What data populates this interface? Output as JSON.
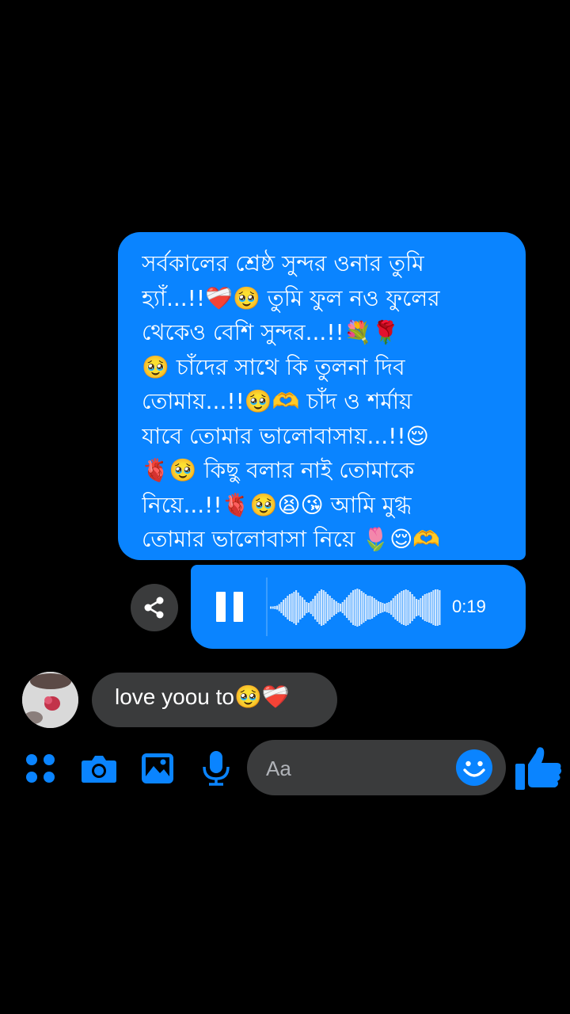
{
  "chat": {
    "sent_message_lines": [
      "সর্বকালের শ্রেষ্ঠ সুন্দর ওনার তুমি",
      "হ্যাঁ...!!❤️‍🩹🥹 তুমি ফুল নও ফুলের",
      "থেকেও বেশি সুন্দর...!!💐🌹",
      "🥹 চাঁদের সাথে কি তুলনা দিব",
      "তোমায়...!!🥹🫶 চাঁদ ও শর্মায়",
      "যাবে তোমার ভালোবাসায়...!!😌",
      "🫀🥹 কিছু বলার নাই তোমাকে",
      "নিয়ে...!!🫀🥹😫😘 আমি মুগ্ধ",
      "তোমার ভালোবাসা নিয়ে 🌷😌🫶"
    ],
    "voice_message": {
      "duration": "0:19",
      "state": "playing"
    },
    "received_message": "love yoou to🥹❤️‍🩹"
  },
  "composer": {
    "placeholder": "Aa",
    "icons": [
      "apps-icon",
      "camera-icon",
      "gallery-icon",
      "microphone-icon",
      "emoji-icon",
      "thumbs-up-icon"
    ]
  },
  "colors": {
    "accent": "#0a84ff",
    "bubble_gray": "#3a3b3c",
    "background": "#000000"
  }
}
